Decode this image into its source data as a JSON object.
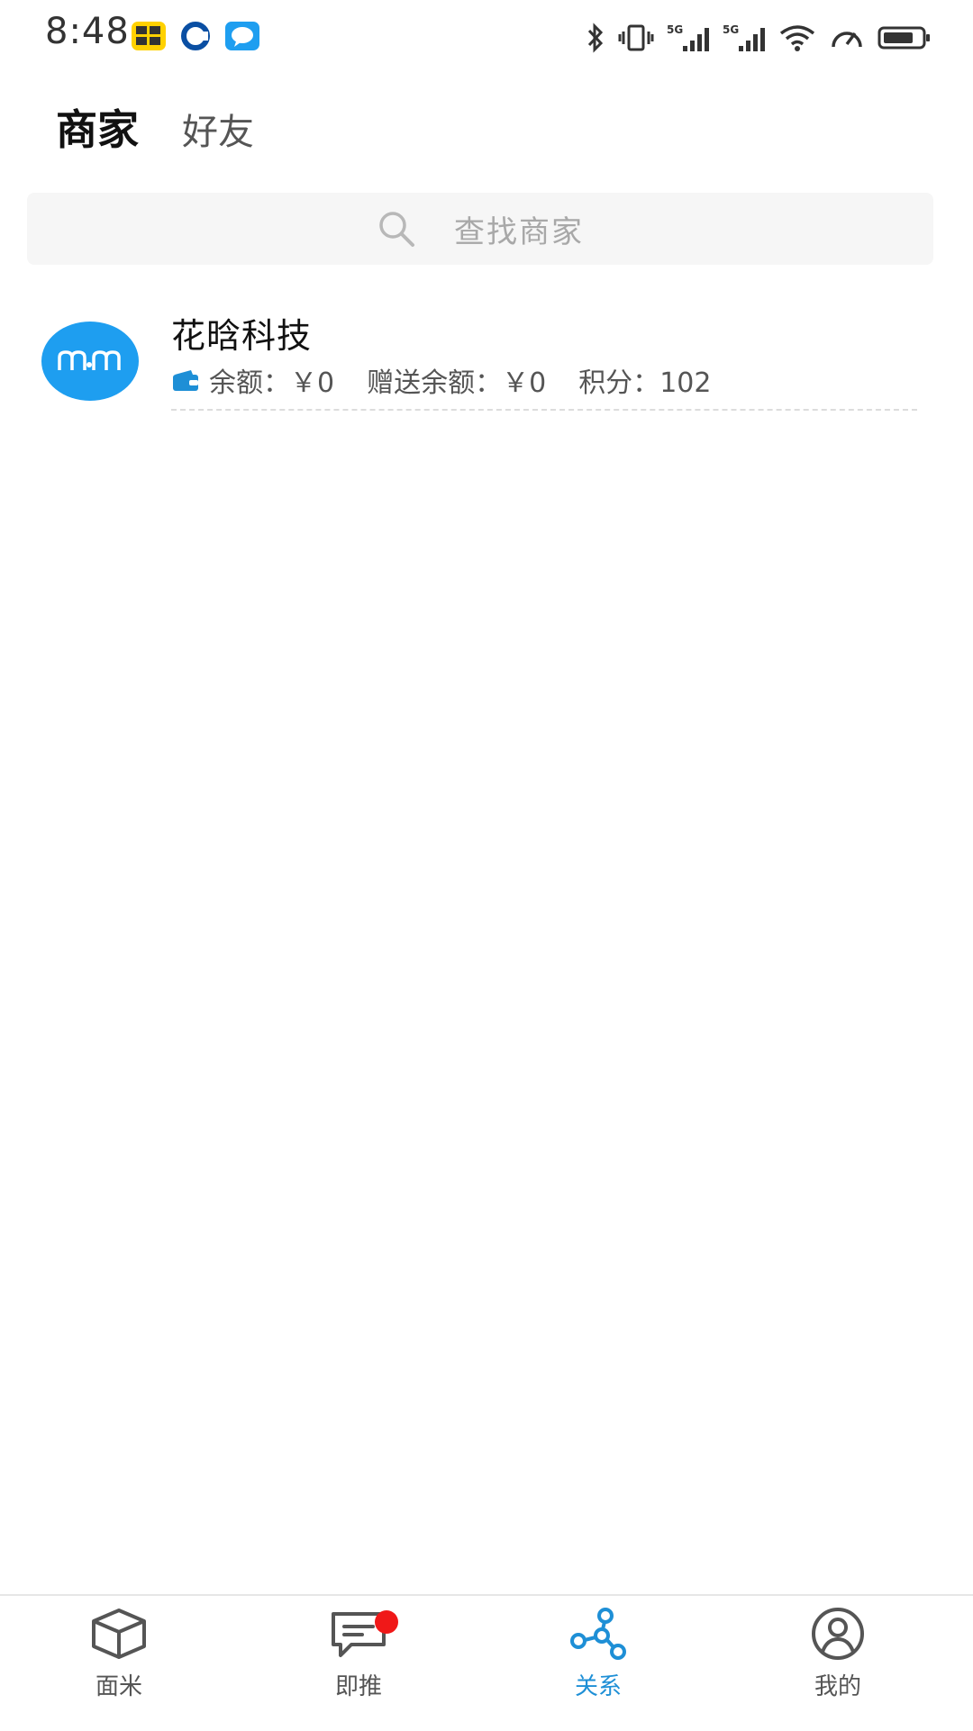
{
  "status_bar": {
    "time": "8:48",
    "icons": [
      "meituan-app-icon",
      "ccb-app-icon",
      "message-app-icon",
      "bluetooth-icon",
      "vibrate-icon",
      "signal-5g-icon",
      "signal-5g-icon",
      "wifi-icon",
      "speedometer-icon",
      "battery-icon"
    ]
  },
  "tabs": {
    "active": "商家",
    "inactive": "好友"
  },
  "search": {
    "placeholder": "查找商家"
  },
  "merchants": [
    {
      "name": "花晗科技",
      "balance_label": "余额：",
      "balance_value": "￥0",
      "gift_label": "赠送余额：",
      "gift_value": "￥0",
      "points_label": "积分：",
      "points_value": "102"
    }
  ],
  "nav": {
    "items": [
      {
        "label": "面米",
        "icon": "box-icon"
      },
      {
        "label": "即推",
        "icon": "chat-icon"
      },
      {
        "label": "关系",
        "icon": "network-icon"
      },
      {
        "label": "我的",
        "icon": "user-icon"
      }
    ],
    "active_index": 2
  },
  "colors": {
    "accent": "#1e8fd6",
    "avatar_bg": "#1e9ef0",
    "badge": "#f01818"
  }
}
